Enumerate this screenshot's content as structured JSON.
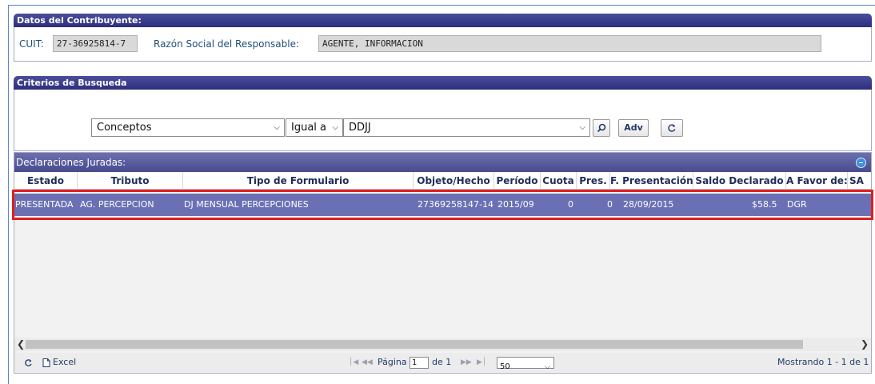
{
  "contribuyente": {
    "title": "Datos del Contribuyente:",
    "cuit_label": "CUIT:",
    "cuit_value": "27-36925814-7",
    "razon_label": "Razón Social del Responsable:",
    "razon_value": "AGENTE, INFORMACION"
  },
  "criterios": {
    "title": "Criterios de Busqueda",
    "field_select": "Conceptos",
    "operator_select": "Igual a",
    "value_select": "DDJJ",
    "adv_label": "Adv"
  },
  "grid": {
    "title": "Declaraciones Juradas:",
    "columns": [
      "Estado",
      "Tributo",
      "Tipo de Formulario",
      "Objeto/Hecho",
      "Período",
      "Cuota",
      "Pres.",
      "F. Presentación",
      "Saldo Declarado",
      "A Favor de:",
      "SA"
    ],
    "rows": [
      {
        "estado": "PRESENTADA",
        "tributo": "AG. PERCEPCION",
        "tipo": "DJ MENSUAL PERCEPCIONES",
        "objeto": "27369258147-14",
        "periodo": "2015/09",
        "cuota": "0",
        "pres": "0",
        "fecha": "28/09/2015",
        "saldo": "$58.5",
        "favor": "DGR"
      }
    ],
    "footer": {
      "excel_label": "Excel",
      "pagina_label": "Página",
      "page_value": "1",
      "de_label": "de 1",
      "page_size": "50",
      "mostrando": "Mostrando 1 - 1 de 1"
    }
  },
  "colors": {
    "header_dark": "#2c2f7d",
    "row_selected": "#6b70b4",
    "highlight": "#e01e1e"
  }
}
